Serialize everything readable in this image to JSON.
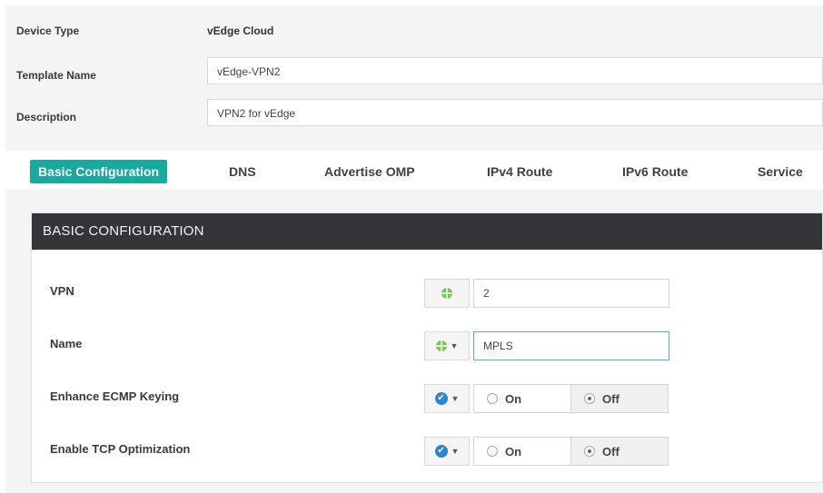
{
  "form": {
    "device_type_label": "Device Type",
    "device_type_value": "vEdge Cloud",
    "template_name_label": "Template Name",
    "template_name_value": "vEdge-VPN2",
    "description_label": "Description",
    "description_value": "VPN2 for vEdge"
  },
  "tabs": [
    {
      "label": "Basic Configuration",
      "active": true
    },
    {
      "label": "DNS",
      "active": false
    },
    {
      "label": "Advertise OMP",
      "active": false
    },
    {
      "label": "IPv4 Route",
      "active": false
    },
    {
      "label": "IPv6 Route",
      "active": false
    },
    {
      "label": "Service",
      "active": false
    }
  ],
  "section": {
    "title": "BASIC CONFIGURATION",
    "rows": [
      {
        "label": "VPN",
        "scope_icon": "globe-icon",
        "value": "2"
      },
      {
        "label": "Name",
        "scope_icon": "globe-icon",
        "value": "MPLS"
      },
      {
        "label": "Enhance ECMP Keying",
        "scope_icon": "check-circle-icon",
        "on_label": "On",
        "off_label": "Off",
        "selected": "Off"
      },
      {
        "label": "Enable TCP Optimization",
        "scope_icon": "check-circle-icon",
        "on_label": "On",
        "off_label": "Off",
        "selected": "Off"
      }
    ]
  },
  "colors": {
    "accent": "#1aa99e",
    "header_bg": "#333538",
    "globe": "#7cc35a",
    "check": "#2f86d0"
  }
}
